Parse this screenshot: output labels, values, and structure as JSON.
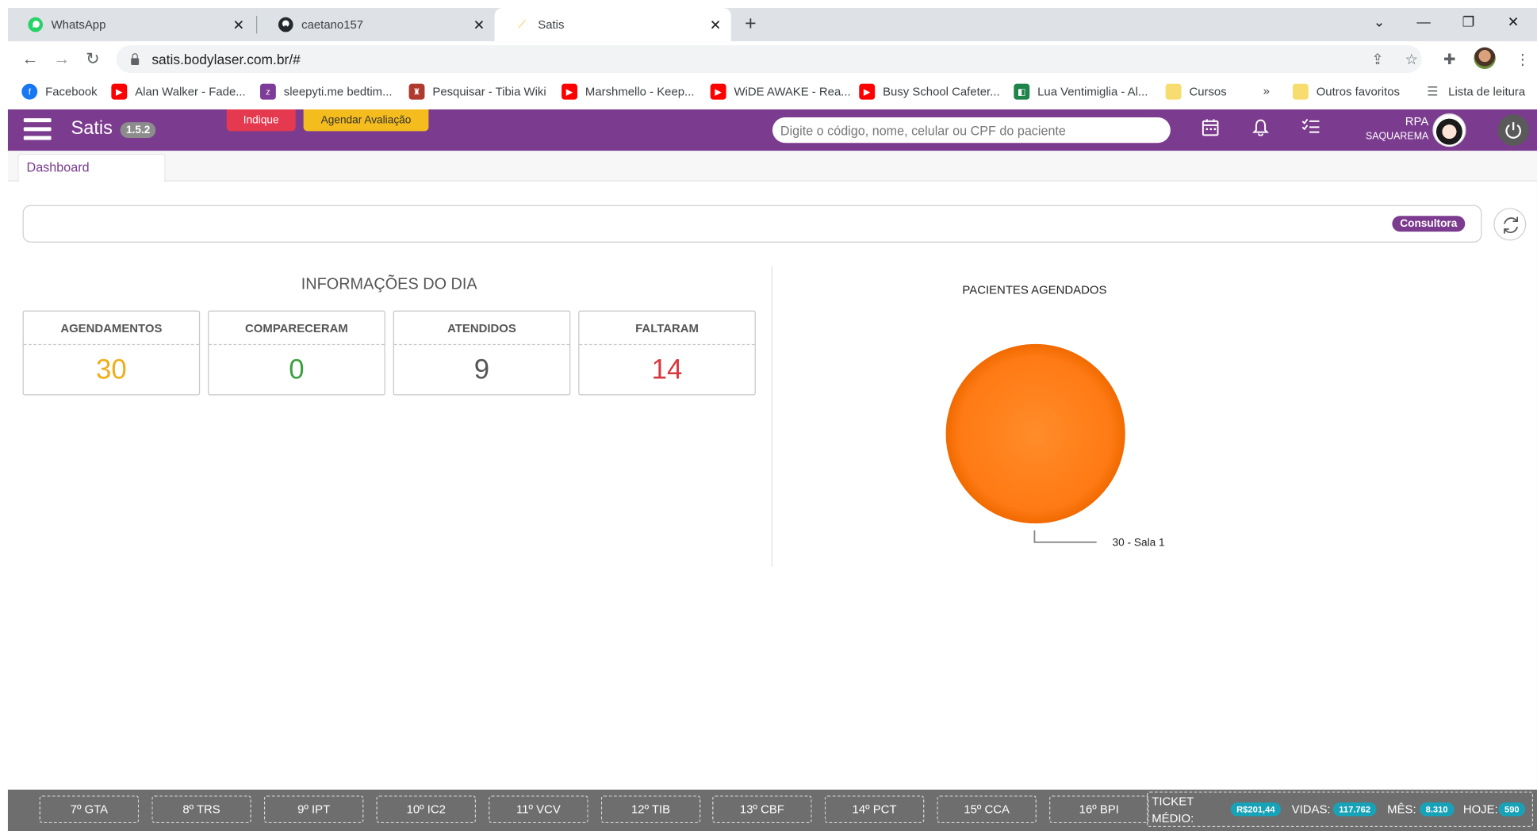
{
  "browser": {
    "tabs": [
      {
        "title": "WhatsApp",
        "icon": "whatsapp-icon"
      },
      {
        "title": "caetano157",
        "icon": "github-icon"
      },
      {
        "title": "Satis",
        "icon": "satis-icon"
      }
    ],
    "url": "satis.bodylaser.com.br/#",
    "bookmarks": [
      {
        "label": "Facebook",
        "icon": "facebook-icon",
        "color": "#1877f2"
      },
      {
        "label": "Alan Walker - Fade...",
        "icon": "youtube-icon",
        "color": "#ff0000"
      },
      {
        "label": "sleepyti.me bedtim...",
        "icon": "sleepytime-icon",
        "color": "#7d3c98"
      },
      {
        "label": "Pesquisar - Tibia Wiki",
        "icon": "tibia-icon",
        "color": "#b03a2e"
      },
      {
        "label": "Marshmello - Keep...",
        "icon": "youtube-icon",
        "color": "#ff0000"
      },
      {
        "label": "WiDE AWAKE - Rea...",
        "icon": "youtube-icon",
        "color": "#ff0000"
      },
      {
        "label": "Busy School Cafeter...",
        "icon": "youtube-icon",
        "color": "#ff0000"
      },
      {
        "label": "Lua Ventimiglia - Al...",
        "icon": "page-icon",
        "color": "#1e8449"
      },
      {
        "label": "Cursos",
        "icon": "folder-icon",
        "color": "#f7dc6f"
      }
    ],
    "more": "»",
    "other_favorites": "Outros favoritos",
    "reading_list": "Lista de leitura"
  },
  "app": {
    "brand": "Satis",
    "version": "1.5.2",
    "indique": "Indique",
    "agendar": "Agendar Avaliação",
    "search_placeholder": "Digite o código, nome, celular ou CPF do paciente",
    "user_name": "RPA",
    "user_location": "SAQUAREMA",
    "dashboard_tab": "Dashboard",
    "consultora": "Consultora"
  },
  "day_info": {
    "title": "INFORMAÇÕES DO DIA",
    "stats": [
      {
        "label": "AGENDAMENTOS",
        "value": "30",
        "color": "#f0ad1a"
      },
      {
        "label": "COMPARECERAM",
        "value": "0",
        "color": "#3aa040"
      },
      {
        "label": "ATENDIDOS",
        "value": "9",
        "color": "#555555"
      },
      {
        "label": "FALTARAM",
        "value": "14",
        "color": "#d9363e"
      }
    ]
  },
  "chart_data": {
    "type": "pie",
    "title": "PACIENTES AGENDADOS",
    "slices": [
      {
        "label": "30 - Sala 1",
        "value": 30,
        "color": "#ff7f1a"
      }
    ]
  },
  "statusbar": {
    "buttons": [
      "7º GTA",
      "8º TRS",
      "9º IPT",
      "10º IC2",
      "11º VCV",
      "12º TIB",
      "13º CBF",
      "14º PCT",
      "15º CCA",
      "16º BPI"
    ],
    "ticket_label": "TICKET MÉDIO:",
    "ticket_value": "R$201,44",
    "vidas_label": "VIDAS:",
    "vidas_value": "117.762",
    "mes_label": "MÊS:",
    "mes_value": "8.310",
    "hoje_label": "HOJE:",
    "hoje_value": "590"
  }
}
